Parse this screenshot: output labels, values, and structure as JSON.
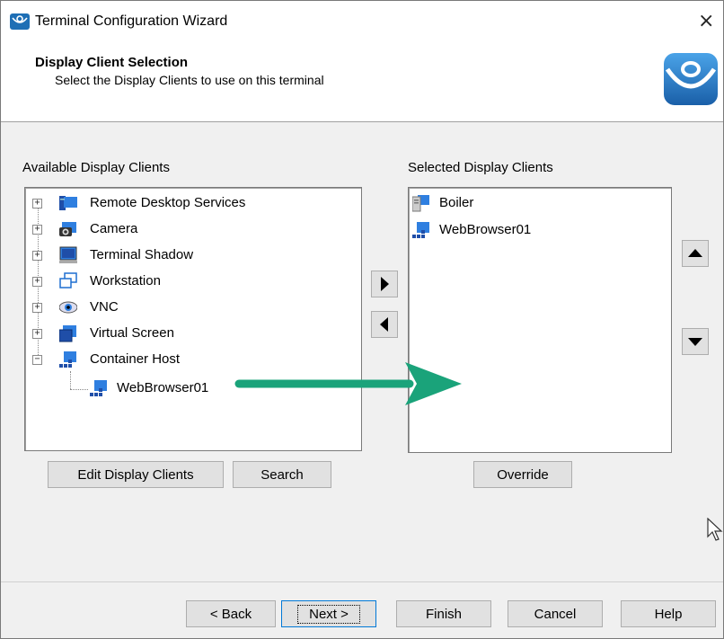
{
  "window": {
    "title": "Terminal Configuration Wizard",
    "close_glyph": "×"
  },
  "header": {
    "title": "Display Client Selection",
    "subtitle": "Select the Display Clients to use on this terminal"
  },
  "available": {
    "label": "Available Display Clients",
    "items": [
      {
        "label": "Remote Desktop Services",
        "icon": "remote-desktop-icon",
        "expander": "+"
      },
      {
        "label": "Camera",
        "icon": "camera-icon",
        "expander": "+"
      },
      {
        "label": "Terminal Shadow",
        "icon": "terminal-shadow-icon",
        "expander": "+"
      },
      {
        "label": "Workstation",
        "icon": "workstation-icon",
        "expander": "+"
      },
      {
        "label": "VNC",
        "icon": "vnc-eye-icon",
        "expander": "+"
      },
      {
        "label": "Virtual Screen",
        "icon": "virtual-screen-icon",
        "expander": "+"
      },
      {
        "label": "Container Host",
        "icon": "container-host-icon",
        "expander": "−"
      }
    ],
    "child": {
      "label": "WebBrowser01",
      "icon": "container-host-icon"
    }
  },
  "selected": {
    "label": "Selected Display Clients",
    "items": [
      {
        "label": "Boiler",
        "icon": "server-icon"
      },
      {
        "label": "WebBrowser01",
        "icon": "container-host-icon"
      }
    ]
  },
  "buttons": {
    "edit": "Edit Display Clients",
    "search": "Search",
    "override": "Override",
    "back": "< Back",
    "next": "Next >",
    "finish": "Finish",
    "cancel": "Cancel",
    "help": "Help"
  },
  "colors": {
    "annotation_arrow": "#1aa37a",
    "accent": "#0078d7"
  }
}
